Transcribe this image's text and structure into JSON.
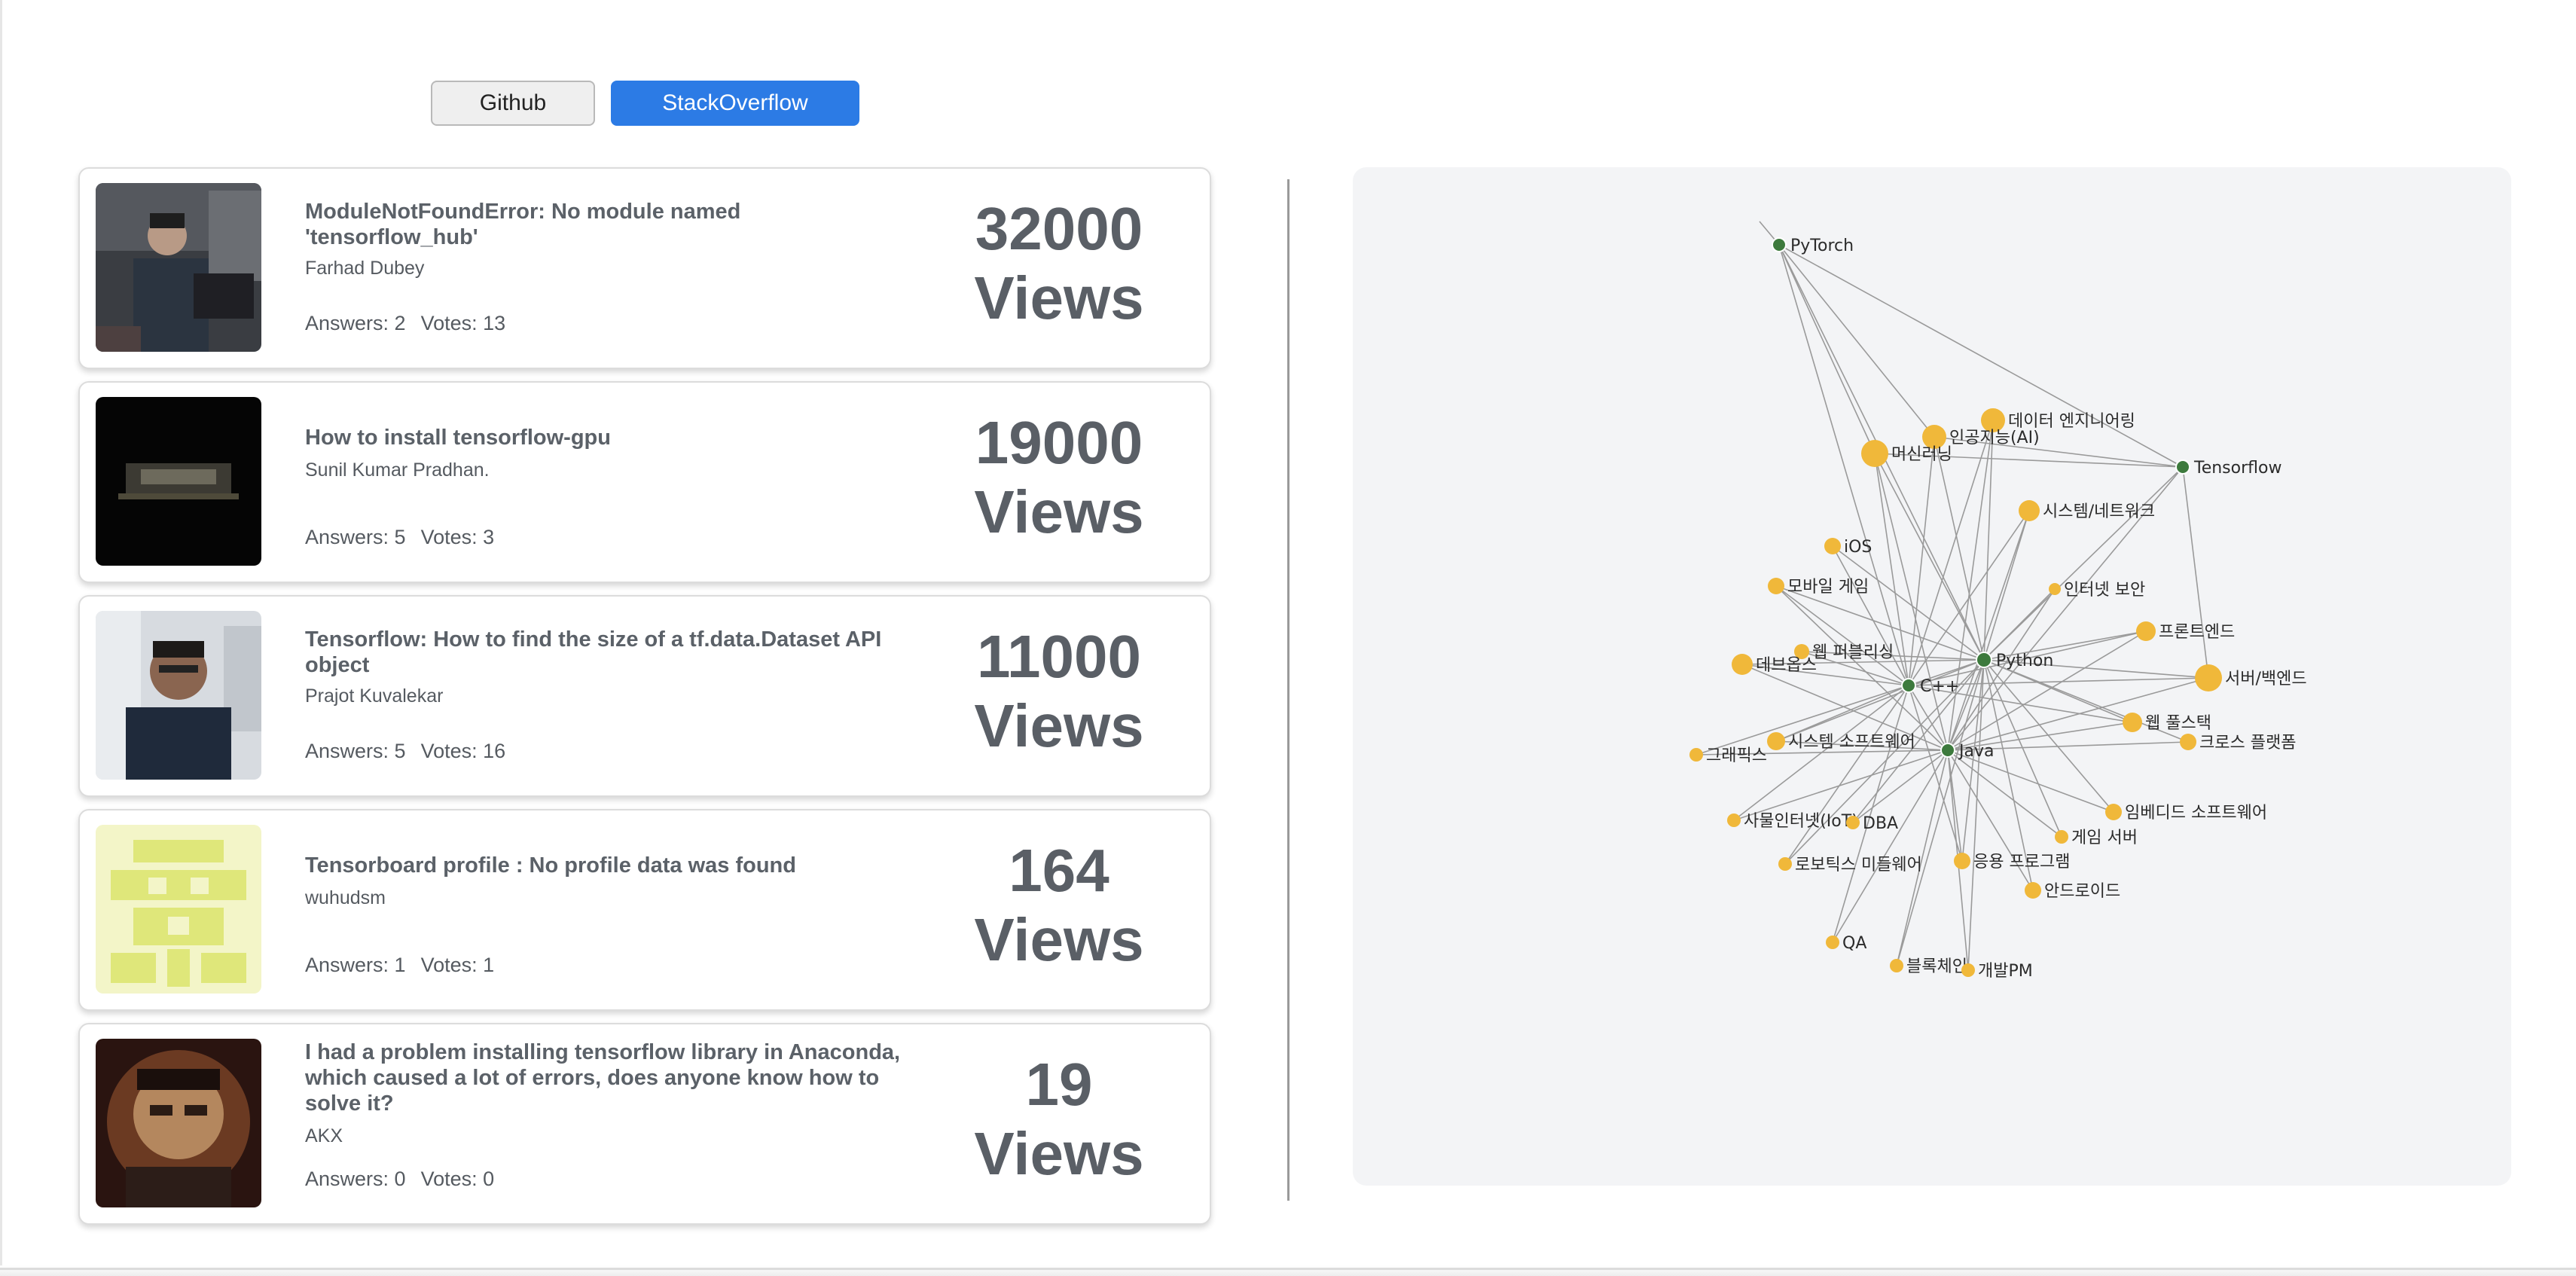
{
  "toggles": {
    "github": "Github",
    "stackoverflow": "StackOverflow"
  },
  "questions": [
    {
      "title": "ModuleNotFoundError: No module named 'tensorflow_hub'",
      "author": "Farhad Dubey",
      "answers_label": "Answers: 2",
      "votes_label": "Votes: 13",
      "views_count": "32000",
      "views_word": "Views"
    },
    {
      "title": "How to install tensorflow-gpu",
      "author": "Sunil Kumar Pradhan.",
      "answers_label": "Answers: 5",
      "votes_label": "Votes: 3",
      "views_count": "19000",
      "views_word": "Views"
    },
    {
      "title": "Tensorflow: How to find the size of a tf.data.Dataset API object",
      "author": "Prajot Kuvalekar",
      "answers_label": "Answers: 5",
      "votes_label": "Votes: 16",
      "views_count": "11000",
      "views_word": "Views"
    },
    {
      "title": "Tensorboard profile : No profile data was found",
      "author": "wuhudsm",
      "answers_label": "Answers: 1",
      "votes_label": "Votes: 1",
      "views_count": "164",
      "views_word": "Views"
    },
    {
      "title": "I had a problem installing tensorflow library in Anaconda, which caused a lot of errors, does anyone know how to solve it?",
      "author": "AKX",
      "answers_label": "Answers: 0",
      "votes_label": "Votes: 0",
      "views_count": "19",
      "views_word": "Views"
    }
  ],
  "graph": {
    "colors": {
      "tech": "#3d7a3d",
      "field": "#f0b83a",
      "edge": "#9a9a9a"
    },
    "tech_nodes": [
      "PyTorch",
      "Tensorflow",
      "Python",
      "C++",
      "Java"
    ],
    "field_nodes": [
      "데이터 엔지니어링",
      "인공지능(AI)",
      "머신러닝",
      "시스템/네트워크",
      "iOS",
      "모바일 게임",
      "인터넷 보안",
      "프론트엔드",
      "웹 퍼블리싱",
      "데브옵스",
      "서버/백엔드",
      "웹 풀스택",
      "시스템 소프트웨어",
      "크로스 플랫폼",
      "그래픽스",
      "임베디드 소프트웨어",
      "사물인터넷(IoT)",
      "DBA",
      "게임 서버",
      "로보틱스 미들웨어",
      "응용 프로그램",
      "안드로이드",
      "QA",
      "블록체인",
      "개발PM"
    ]
  }
}
